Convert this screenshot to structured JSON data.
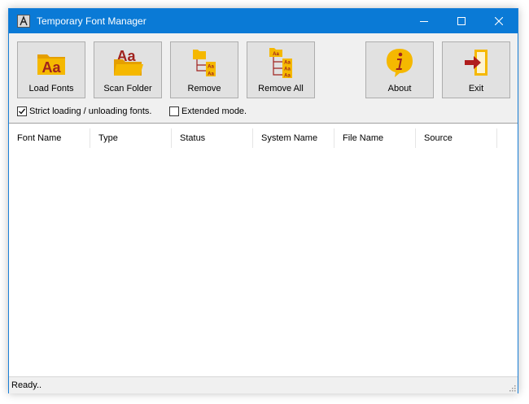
{
  "window": {
    "title": "Temporary Font Manager",
    "controls": [
      "minimize-icon",
      "maximize-icon",
      "close-icon"
    ]
  },
  "toolbar": {
    "buttons": [
      {
        "label": "Load Fonts",
        "icon": "load-fonts-icon"
      },
      {
        "label": "Scan Folder",
        "icon": "scan-folder-icon"
      },
      {
        "label": "Remove",
        "icon": "remove-icon"
      },
      {
        "label": "Remove All",
        "icon": "remove-all-icon"
      },
      {
        "label": "About",
        "icon": "about-icon"
      },
      {
        "label": "Exit",
        "icon": "exit-icon"
      }
    ]
  },
  "options": {
    "strict_label": "Strict loading / unloading fonts.",
    "strict_checked": true,
    "extended_label": "Extended mode.",
    "extended_checked": false
  },
  "list": {
    "columns": [
      "Font Name",
      "Type",
      "Status",
      "System Name",
      "File Name",
      "Source"
    ],
    "rows": []
  },
  "status": {
    "text": "Ready.."
  },
  "colors": {
    "titlebar": "#0a7ad6",
    "folder": "#f5b800",
    "letters": "#a0221e",
    "exit_arrow": "#b01e1e"
  }
}
